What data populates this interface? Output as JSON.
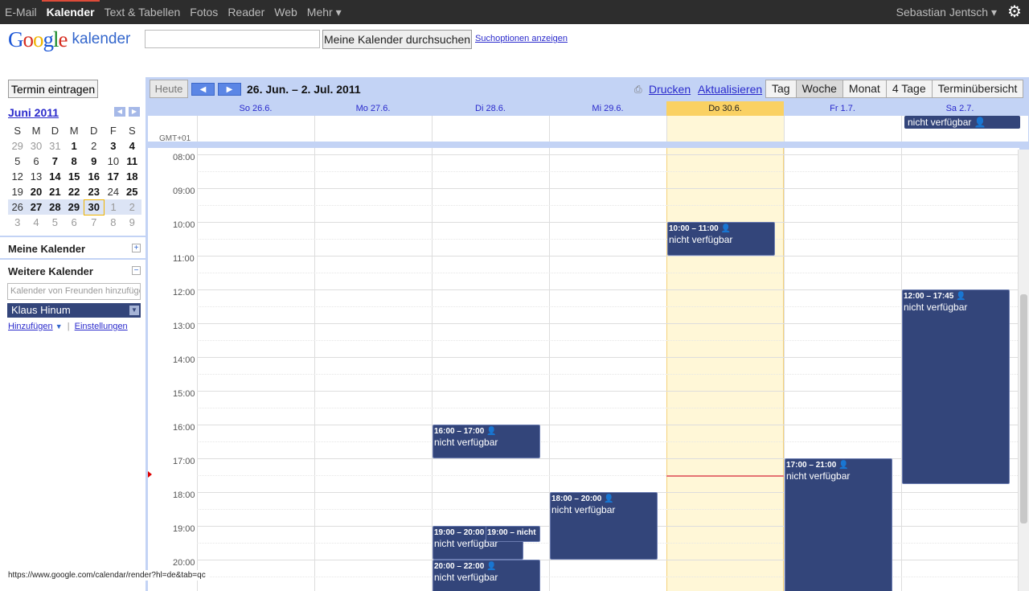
{
  "topbar": {
    "nav": [
      "E-Mail",
      "Kalender",
      "Text & Tabellen",
      "Fotos",
      "Reader",
      "Web",
      "Mehr ▾"
    ],
    "active": "Kalender",
    "user": "Sebastian Jentsch ▾",
    "gear_icon": "gear-icon"
  },
  "header": {
    "logo_text": "Google",
    "logo_suffix": "kalender",
    "search_placeholder": "",
    "search_button": "Meine Kalender durchsuchen",
    "search_options": "Suchoptionen anzeigen"
  },
  "left": {
    "create_button": "Termin eintragen",
    "mini_title": "Juni 2011",
    "weekday_headers": [
      "S",
      "M",
      "D",
      "M",
      "D",
      "F",
      "S"
    ],
    "weeks": [
      [
        "29",
        "30",
        "31",
        "1",
        "2",
        "3",
        "4"
      ],
      [
        "5",
        "6",
        "7",
        "8",
        "9",
        "10",
        "11"
      ],
      [
        "12",
        "13",
        "14",
        "15",
        "16",
        "17",
        "18"
      ],
      [
        "19",
        "20",
        "21",
        "22",
        "23",
        "24",
        "25"
      ],
      [
        "26",
        "27",
        "28",
        "29",
        "30",
        "1",
        "2"
      ],
      [
        "3",
        "4",
        "5",
        "6",
        "7",
        "8",
        "9"
      ]
    ],
    "my_calendars": "Meine Kalender",
    "other_calendars": "Weitere Kalender",
    "friend_placeholder": "Kalender von Freunden hinzufüge",
    "klaus": "Klaus Hinum",
    "add_link": "Hinzufügen",
    "settings_link": "Einstellungen"
  },
  "main": {
    "today": "Heute",
    "date_range": "26. Jun. – 2. Jul. 2011",
    "print": "Drucken",
    "refresh": "Aktualisieren",
    "views": [
      "Tag",
      "Woche",
      "Monat",
      "4 Tage",
      "Terminübersicht"
    ],
    "selected_view": "Woche",
    "days": [
      "So 26.6.",
      "Mo 27.6.",
      "Di 28.6.",
      "Mi 29.6.",
      "Do 30.6.",
      "Fr 1.7.",
      "Sa 2.7."
    ],
    "today_index": 4,
    "timezone": "GMT+01",
    "allday_event": "nicht verfügbar",
    "hours": [
      "08:00",
      "09:00",
      "10:00",
      "11:00",
      "12:00",
      "13:00",
      "14:00",
      "15:00",
      "16:00",
      "17:00",
      "18:00",
      "19:00",
      "20:00"
    ],
    "events": [
      {
        "time": "10:00 – 11:00",
        "title": "nicht verfügbar"
      },
      {
        "time": "12:00 – 17:45",
        "title": "nicht verfügbar"
      },
      {
        "time": "16:00 – 17:00",
        "title": "nicht verfügbar"
      },
      {
        "time": "17:00 – 21:00",
        "title": "nicht verfügbar"
      },
      {
        "time": "18:00 – 20:00",
        "title": "nicht verfügbar"
      },
      {
        "time": "19:00 – 20:00",
        "title": "nicht verfügbar"
      },
      {
        "time": "19:00 – nicht",
        "title": ""
      },
      {
        "time": "20:00 – 22:00",
        "title": "nicht verfügbar"
      }
    ]
  },
  "status_url": "https://www.google.com/calendar/render?hl=de&tab=qc",
  "colors": {
    "event": "#33457a",
    "today_header": "#fad163",
    "today_col": "#fff7d7",
    "panel": "#c3d3f5"
  }
}
